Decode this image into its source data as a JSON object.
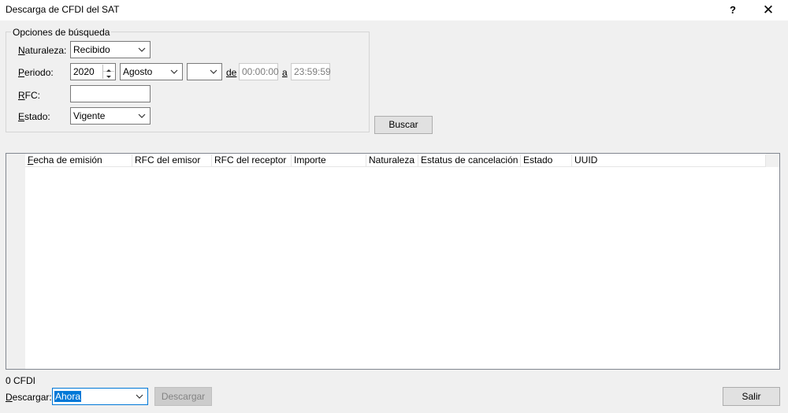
{
  "window": {
    "title": "Descarga de CFDI del SAT",
    "help_label": "?",
    "close_label": "✕"
  },
  "search_options": {
    "legend": "Opciones de búsqueda",
    "naturaleza": {
      "label_prefix": "N",
      "label_rest": "aturaleza:",
      "value": "Recibido"
    },
    "periodo": {
      "label_prefix": "P",
      "label_rest": "eriodo:",
      "year": "2020",
      "month": "Agosto",
      "day": "",
      "de_label": "de",
      "time_from": "00:00:00",
      "a_label": "a",
      "time_to": "23:59:59"
    },
    "rfc": {
      "label_prefix": "R",
      "label_rest": "FC:",
      "value": ""
    },
    "estado": {
      "label_prefix": "E",
      "label_rest": "stado:",
      "value": "Vigente"
    }
  },
  "buscar_label": "Buscar",
  "table": {
    "columns": [
      {
        "prefix": "F",
        "rest": "echa de emisión"
      },
      {
        "prefix": "",
        "rest": "RFC del emisor"
      },
      {
        "prefix": "",
        "rest": "RFC del receptor"
      },
      {
        "prefix": "",
        "rest": "Importe"
      },
      {
        "prefix": "",
        "rest": "Naturaleza"
      },
      {
        "prefix": "",
        "rest": "Estatus de cancelación"
      },
      {
        "prefix": "",
        "rest": "Estado"
      },
      {
        "prefix": "",
        "rest": "UUID"
      }
    ],
    "rows": []
  },
  "status": {
    "count": "0 CFDI"
  },
  "footer": {
    "descargar_prefix": "D",
    "descargar_rest": "escargar:",
    "descargar_value": "Ahora",
    "descargar_button": "Descargar",
    "salir_button": "Salir"
  }
}
